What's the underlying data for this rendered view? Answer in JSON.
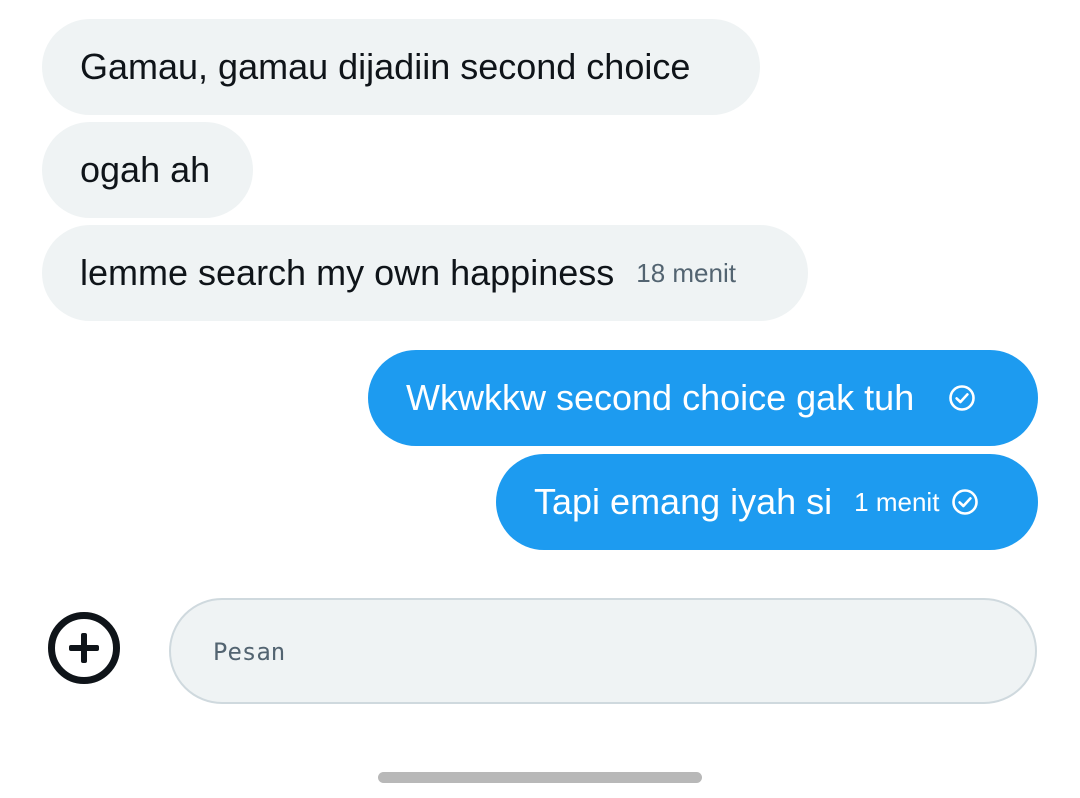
{
  "messages": [
    {
      "direction": "incoming",
      "text": "Gamau, gamau dijadiin second choice",
      "time": ""
    },
    {
      "direction": "incoming",
      "text": "ogah ah",
      "time": ""
    },
    {
      "direction": "incoming",
      "text": "lemme search my own happiness",
      "time": "18 menit"
    },
    {
      "direction": "outgoing",
      "text": "Wkwkkw second choice gak tuh",
      "time": "",
      "status_icon": "sent-check-icon"
    },
    {
      "direction": "outgoing",
      "text": "Tapi emang iyah si",
      "time": "1 menit",
      "status_icon": "sent-check-icon"
    }
  ],
  "composer": {
    "placeholder": "Pesan",
    "add_icon": "plus-circle-icon"
  },
  "colors": {
    "incoming_bubble": "#eff3f4",
    "outgoing_bubble": "#1d9bf0",
    "text": "#0f1419",
    "muted_text": "#536471"
  }
}
